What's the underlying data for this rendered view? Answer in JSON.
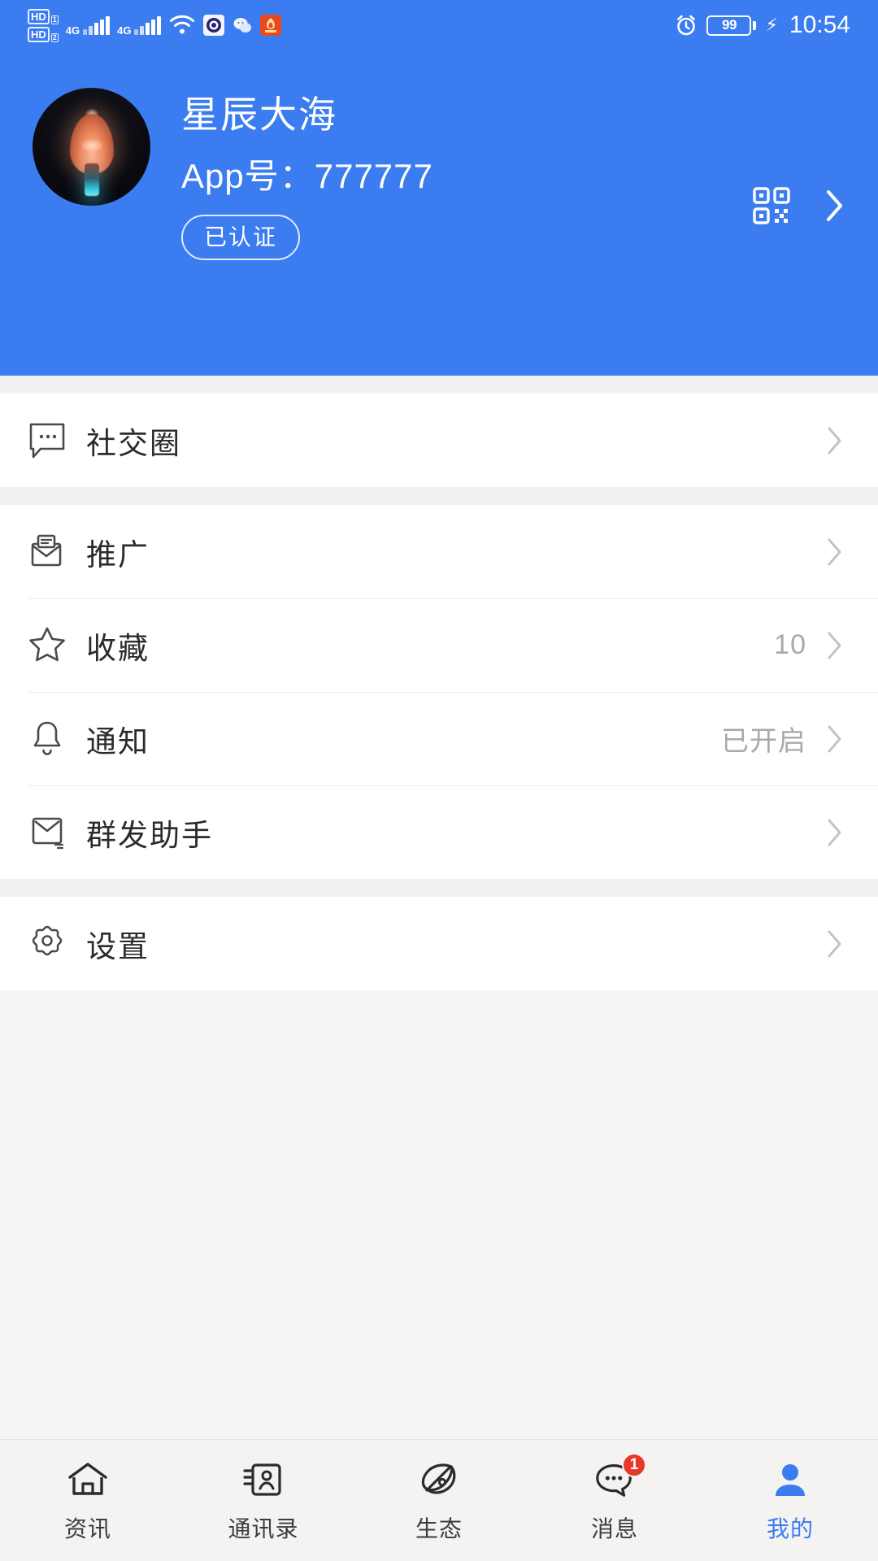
{
  "theme": {
    "primary": "#3b7cf0",
    "page_bg": "#f2f2f2",
    "card_bg": "#ffffff",
    "badge_red": "#e8372b",
    "muted_text": "#a9a9a9"
  },
  "statusbar": {
    "hd1": "HD",
    "hd1_sub": "1",
    "hd2": "HD",
    "hd2_sub": "2",
    "net1": "4G",
    "net2": "4G",
    "wifi_icon": "wifi-icon",
    "app_icon_1": "app-badge-icon",
    "app_icon_2": "wechat-icon",
    "app_icon_3": "notification-app-icon",
    "alarm_icon": "alarm-clock-icon",
    "battery_level": "99",
    "charging_icon": "charging-bolt-icon",
    "time": "10:54"
  },
  "header": {
    "avatar": "user-avatar-lantern",
    "username": "星辰大海",
    "user_id_label": "App号：",
    "user_id_value": "777777",
    "verified_badge": "已认证",
    "qr_icon": "qr-code-icon",
    "chevron_icon": "chevron-right-icon"
  },
  "sections": [
    {
      "id": "social",
      "rows": [
        {
          "id": "social-circle",
          "icon": "chat-bubble-dots-icon",
          "label": "社交圈",
          "value": ""
        }
      ]
    },
    {
      "id": "tools",
      "rows": [
        {
          "id": "promotion",
          "icon": "open-envelope-icon",
          "label": "推广",
          "value": ""
        },
        {
          "id": "favorites",
          "icon": "star-icon",
          "label": "收藏",
          "value": "10"
        },
        {
          "id": "notifications",
          "icon": "bell-icon",
          "label": "通知",
          "value": "已开启"
        },
        {
          "id": "mass-message",
          "icon": "envelope-icon",
          "label": "群发助手",
          "value": ""
        }
      ]
    },
    {
      "id": "settings",
      "rows": [
        {
          "id": "settings",
          "icon": "gear-icon",
          "label": "设置",
          "value": ""
        }
      ]
    }
  ],
  "tabbar": {
    "items": [
      {
        "id": "news",
        "icon": "home-icon",
        "label": "资讯",
        "active": false,
        "badge": ""
      },
      {
        "id": "contacts",
        "icon": "contact-card-icon",
        "label": "通讯录",
        "active": false,
        "badge": ""
      },
      {
        "id": "ecology",
        "icon": "ecology-icon",
        "label": "生态",
        "active": false,
        "badge": ""
      },
      {
        "id": "messages",
        "icon": "chat-bubble-icon",
        "label": "消息",
        "active": false,
        "badge": "1"
      },
      {
        "id": "mine",
        "icon": "person-icon",
        "label": "我的",
        "active": true,
        "badge": ""
      }
    ]
  }
}
